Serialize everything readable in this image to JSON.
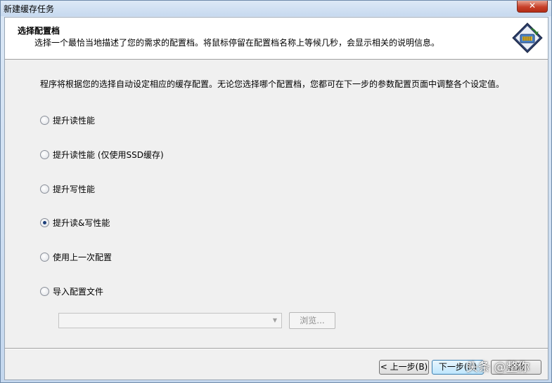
{
  "window": {
    "title": "新建缓存任务",
    "close_label": "✕"
  },
  "header": {
    "title": "选择配置档",
    "description": "选择一个最恰当地描述了您的需求的配置档。将鼠标停留在配置档名称上等候几秒，会显示相关的说明信息。",
    "logo_icon": "cache-wizard-logo-icon"
  },
  "intro": "程序将根据您的选择自动设定相应的缓存配置。无论您选择哪个配置档，您都可在下一步的参数配置页面中调整各个设定值。",
  "profiles": [
    {
      "label": "提升读性能",
      "checked": false
    },
    {
      "label": "提升读性能 (仅使用SSD缓存)",
      "checked": false
    },
    {
      "label": "提升写性能",
      "checked": false
    },
    {
      "label": "提升读&写性能",
      "checked": true
    },
    {
      "label": "使用上一次配置",
      "checked": false
    },
    {
      "label": "导入配置文件",
      "checked": false
    }
  ],
  "import": {
    "file_value": "",
    "browse_label": "浏览..."
  },
  "buttons": {
    "back": "< 上一步(B)",
    "next": "下一步(N)",
    "cancel": "取消"
  },
  "watermark": "头条 @整你",
  "colors": {
    "accent": "#3c7fb1",
    "close": "#c8412a",
    "disabled_text": "#8d8d8d"
  }
}
